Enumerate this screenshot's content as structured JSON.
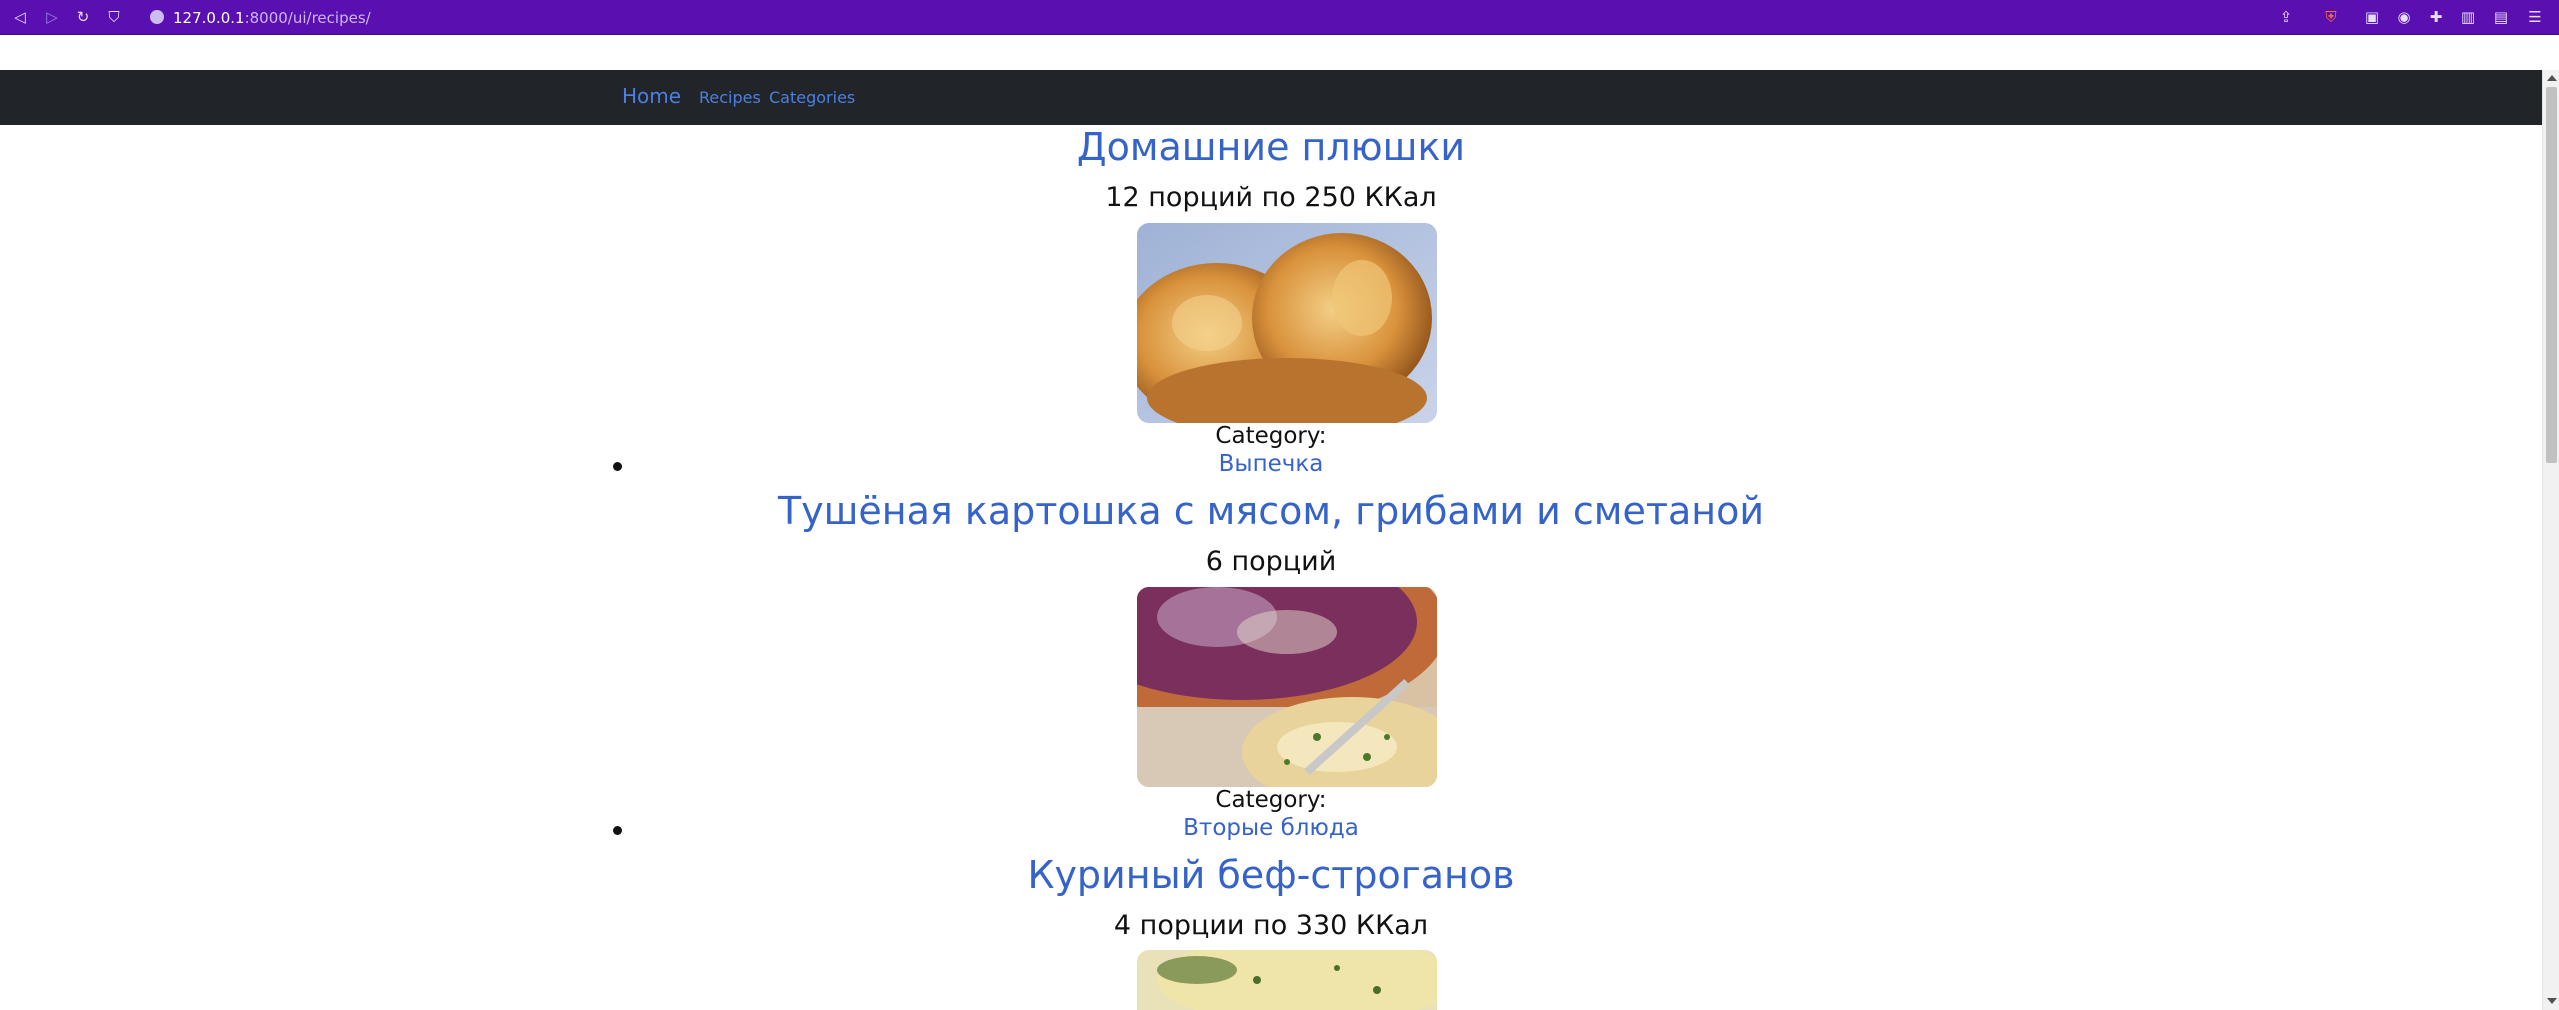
{
  "browser": {
    "url_host": "127.0.0.1",
    "url_rest": ":8000/ui/recipes/"
  },
  "navbar": {
    "brand": "Home",
    "links": [
      "Recipes",
      "Categories"
    ]
  },
  "recipes": [
    {
      "title": "Домашние плюшки",
      "meta": "12 порций по 250 ККал",
      "category_label": "Category:",
      "category": "Выпечка"
    },
    {
      "title": "Тушёная картошка с мясом, грибами и сметаной",
      "meta": "6 порций",
      "category_label": "Category:",
      "category": "Вторые блюда"
    },
    {
      "title": "Куриный беф-строганов",
      "meta": "4 порции по 330 ККал"
    }
  ]
}
